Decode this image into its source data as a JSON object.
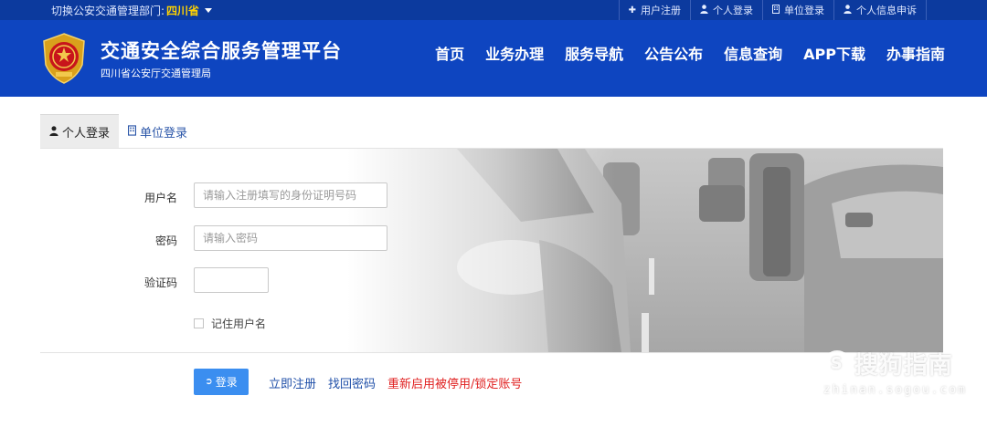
{
  "topbar": {
    "switch_label": "切换公安交通管理部门:",
    "province": "四川省",
    "links": [
      {
        "icon": "plus-icon",
        "glyph": "✚",
        "label": "用户注册"
      },
      {
        "icon": "user-icon",
        "glyph": "👤",
        "label": "个人登录"
      },
      {
        "icon": "building-icon",
        "glyph": "▯",
        "label": "单位登录"
      },
      {
        "icon": "user-icon",
        "glyph": "👤",
        "label": "个人信息申诉"
      }
    ]
  },
  "header": {
    "title": "交通安全综合服务管理平台",
    "subtitle": "四川省公安厅交通管理局",
    "nav": [
      "首页",
      "业务办理",
      "服务导航",
      "公告公布",
      "信息查询",
      "APP下载",
      "办事指南"
    ]
  },
  "tabs": [
    {
      "label": "个人登录",
      "active": true
    },
    {
      "label": "单位登录",
      "active": false
    }
  ],
  "form": {
    "username_label": "用户名",
    "username_placeholder": "请输入注册填写的身份证明号码",
    "password_label": "密码",
    "password_placeholder": "请输入密码",
    "captcha_label": "验证码",
    "remember_label": "记住用户名"
  },
  "actions": {
    "login_label": "登录",
    "register_label": "立即注册",
    "recover_label": "找回密码",
    "reactivate_label": "重新启用被停用/锁定账号"
  },
  "watermark": {
    "brand": "搜狗指南",
    "url": "zhinan.sogou.com"
  },
  "colors": {
    "topbar_bg": "#0c3a9e",
    "header_bg": "#0e45c0",
    "province_highlight": "#ffd200",
    "primary_button": "#3b8ef0",
    "link_blue": "#1f4fa8",
    "link_red": "#e02020"
  }
}
